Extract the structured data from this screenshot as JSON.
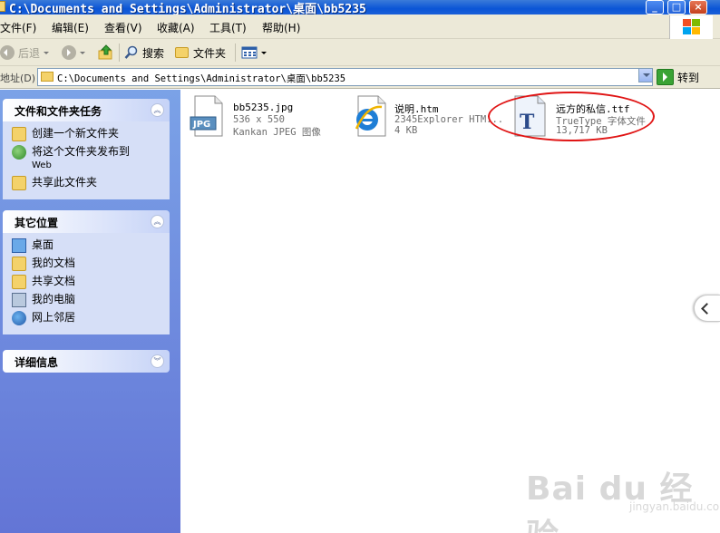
{
  "window": {
    "title": "C:\\Documents and Settings\\Administrator\\桌面\\bb5235",
    "minimize": "_",
    "maximize": "□",
    "close": "×"
  },
  "menu": [
    "文件(F)",
    "编辑(E)",
    "查看(V)",
    "收藏(A)",
    "工具(T)",
    "帮助(H)"
  ],
  "toolbar": {
    "back_label": "后退",
    "search_label": "搜索",
    "folders_label": "文件夹"
  },
  "address": {
    "label": "地址(D)",
    "value": "C:\\Documents and Settings\\Administrator\\桌面\\bb5235",
    "go_label": "转到"
  },
  "sidebar": {
    "tasks": {
      "title": "文件和文件夹任务",
      "items": [
        {
          "label": "创建一个新文件夹",
          "icon": "new-folder-icon"
        },
        {
          "label": "将这个文件夹发布到",
          "sub": "Web",
          "icon": "publish-web-icon"
        },
        {
          "label": "共享此文件夹",
          "icon": "share-folder-icon"
        }
      ]
    },
    "places": {
      "title": "其它位置",
      "items": [
        {
          "label": "桌面",
          "icon": "desktop-icon"
        },
        {
          "label": "我的文档",
          "icon": "my-documents-icon"
        },
        {
          "label": "共享文档",
          "icon": "shared-documents-icon"
        },
        {
          "label": "我的电脑",
          "icon": "my-computer-icon"
        },
        {
          "label": "网上邻居",
          "icon": "network-places-icon"
        }
      ]
    },
    "details": {
      "title": "详细信息"
    }
  },
  "files": [
    {
      "name": "bb5235.jpg",
      "line2": "536 x 550",
      "line3": "Kankan JPEG 图像",
      "icon": "jpg-file-icon",
      "icon_text": "JPG"
    },
    {
      "name": "说明.htm",
      "line2": "2345Explorer HTM...",
      "line3": "4 KB",
      "icon": "ie-html-icon"
    },
    {
      "name": "远方的私信.ttf",
      "line2": "TrueType 字体文件",
      "line3": "13,717 KB",
      "icon": "truetype-font-icon",
      "icon_text": "T"
    }
  ],
  "watermark": {
    "brand": "Bai du 经验",
    "url": "jingyan.baidu.com"
  }
}
